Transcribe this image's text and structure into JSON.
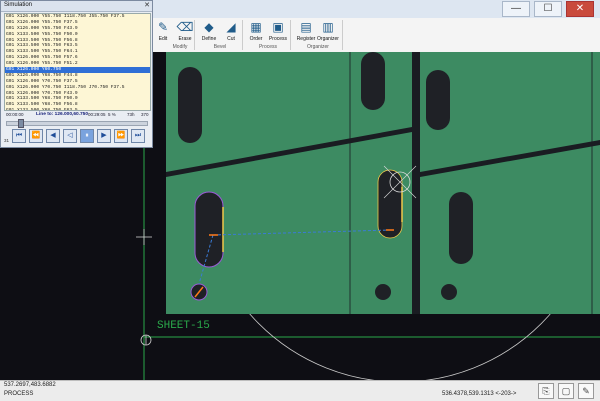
{
  "window": {
    "title": "",
    "controls": {
      "minimize": "—",
      "maximize": "☐",
      "close": "✕"
    }
  },
  "ribbon": {
    "buttons": [
      {
        "label": "Edit",
        "icon": "edit-icon"
      },
      {
        "label": "Erase",
        "icon": "erase-icon"
      },
      {
        "label": "Define",
        "icon": "define-icon"
      },
      {
        "label": "Cut",
        "icon": "cut-icon"
      },
      {
        "label": "Order",
        "icon": "order-icon"
      },
      {
        "label": "Process",
        "icon": "process-icon"
      },
      {
        "label": "Register",
        "icon": "register-icon"
      },
      {
        "label": "Organizer",
        "icon": "organizer-icon"
      }
    ],
    "groups": [
      "Modify",
      "Bevel",
      "Process",
      "Organizer"
    ]
  },
  "simulation": {
    "title": "Simulation",
    "close": "✕",
    "code_lines": [
      "G01 X126.000 Y55.750 I118.750 J55.750 F37.5",
      "G01 X126.000 Y55.750 F37.5",
      "G01 X126.000 Y55.750 F43.9",
      "G01 X133.500 Y55.750 F50.0",
      "G01 X133.500 Y55.750 F56.8",
      "G01 X133.500 Y55.750 F63.5",
      "G01 X133.500 Y55.750 F64.1",
      "G01 X126.000 Y55.750 F57.6",
      "G01 X126.000 Y55.750 F51.2",
      "G01 X126.000 Y60.750",
      "G01 X126.000 Y68.750 F44.8",
      "G01 X126.000 Y70.750 F37.5",
      "G01 X126.000 Y70.750 I118.750 J70.750 F37.5",
      "G01 X126.000 Y70.750 F43.9",
      "G01 X133.500 Y68.750 F50.0",
      "G01 X133.500 Y68.750 F56.8",
      "G01 X133.500 Y68.750 F63.5",
      "G01 X133.500 Y55.750 F64.1",
      "G01 X133.500 Y55.750 F57.6",
      "G01 X133.500 Y55.750 F51.2"
    ],
    "highlighted_index": 9,
    "time_start": "00:00:00",
    "time_current": "00:29:05",
    "time_end": "73h",
    "line_label": "Line to: 126.000,60.750",
    "percent": "5 %",
    "speed_max": "370",
    "counter": "31",
    "buttons": {
      "first": "⏮",
      "prev": "⏪",
      "back": "◀",
      "play_back": "◁",
      "pause": "⏸",
      "play": "▶",
      "next": "⏩",
      "last": "⏭"
    }
  },
  "canvas": {
    "sheet_label": "SHEET-15",
    "colors": {
      "sheet": "#3d8b62",
      "background": "#0e0e14",
      "hole": "#1f2126",
      "highlight": "#f0c84a",
      "purple": "#9a5bd6"
    }
  },
  "status": {
    "coords_left": "537.2697,483.6882",
    "mode": "PROCESS",
    "coords_right": "536.4378,539.1313 <-203->",
    "icons": [
      "copy-icon",
      "window-icon",
      "edit-icon"
    ]
  }
}
